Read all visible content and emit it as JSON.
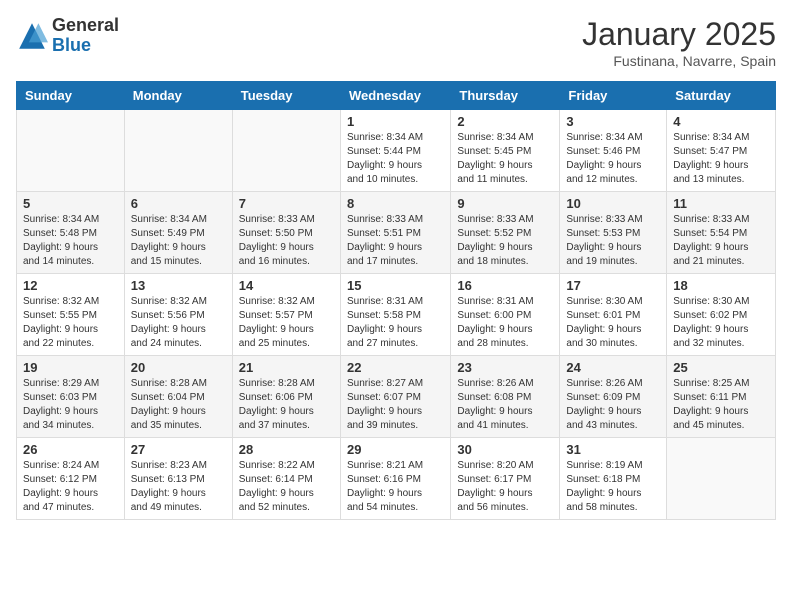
{
  "header": {
    "logo_general": "General",
    "logo_blue": "Blue",
    "month_title": "January 2025",
    "location": "Fustinana, Navarre, Spain"
  },
  "weekdays": [
    "Sunday",
    "Monday",
    "Tuesday",
    "Wednesday",
    "Thursday",
    "Friday",
    "Saturday"
  ],
  "weeks": [
    [
      {
        "day": "",
        "info": ""
      },
      {
        "day": "",
        "info": ""
      },
      {
        "day": "",
        "info": ""
      },
      {
        "day": "1",
        "info": "Sunrise: 8:34 AM\nSunset: 5:44 PM\nDaylight: 9 hours\nand 10 minutes."
      },
      {
        "day": "2",
        "info": "Sunrise: 8:34 AM\nSunset: 5:45 PM\nDaylight: 9 hours\nand 11 minutes."
      },
      {
        "day": "3",
        "info": "Sunrise: 8:34 AM\nSunset: 5:46 PM\nDaylight: 9 hours\nand 12 minutes."
      },
      {
        "day": "4",
        "info": "Sunrise: 8:34 AM\nSunset: 5:47 PM\nDaylight: 9 hours\nand 13 minutes."
      }
    ],
    [
      {
        "day": "5",
        "info": "Sunrise: 8:34 AM\nSunset: 5:48 PM\nDaylight: 9 hours\nand 14 minutes."
      },
      {
        "day": "6",
        "info": "Sunrise: 8:34 AM\nSunset: 5:49 PM\nDaylight: 9 hours\nand 15 minutes."
      },
      {
        "day": "7",
        "info": "Sunrise: 8:33 AM\nSunset: 5:50 PM\nDaylight: 9 hours\nand 16 minutes."
      },
      {
        "day": "8",
        "info": "Sunrise: 8:33 AM\nSunset: 5:51 PM\nDaylight: 9 hours\nand 17 minutes."
      },
      {
        "day": "9",
        "info": "Sunrise: 8:33 AM\nSunset: 5:52 PM\nDaylight: 9 hours\nand 18 minutes."
      },
      {
        "day": "10",
        "info": "Sunrise: 8:33 AM\nSunset: 5:53 PM\nDaylight: 9 hours\nand 19 minutes."
      },
      {
        "day": "11",
        "info": "Sunrise: 8:33 AM\nSunset: 5:54 PM\nDaylight: 9 hours\nand 21 minutes."
      }
    ],
    [
      {
        "day": "12",
        "info": "Sunrise: 8:32 AM\nSunset: 5:55 PM\nDaylight: 9 hours\nand 22 minutes."
      },
      {
        "day": "13",
        "info": "Sunrise: 8:32 AM\nSunset: 5:56 PM\nDaylight: 9 hours\nand 24 minutes."
      },
      {
        "day": "14",
        "info": "Sunrise: 8:32 AM\nSunset: 5:57 PM\nDaylight: 9 hours\nand 25 minutes."
      },
      {
        "day": "15",
        "info": "Sunrise: 8:31 AM\nSunset: 5:58 PM\nDaylight: 9 hours\nand 27 minutes."
      },
      {
        "day": "16",
        "info": "Sunrise: 8:31 AM\nSunset: 6:00 PM\nDaylight: 9 hours\nand 28 minutes."
      },
      {
        "day": "17",
        "info": "Sunrise: 8:30 AM\nSunset: 6:01 PM\nDaylight: 9 hours\nand 30 minutes."
      },
      {
        "day": "18",
        "info": "Sunrise: 8:30 AM\nSunset: 6:02 PM\nDaylight: 9 hours\nand 32 minutes."
      }
    ],
    [
      {
        "day": "19",
        "info": "Sunrise: 8:29 AM\nSunset: 6:03 PM\nDaylight: 9 hours\nand 34 minutes."
      },
      {
        "day": "20",
        "info": "Sunrise: 8:28 AM\nSunset: 6:04 PM\nDaylight: 9 hours\nand 35 minutes."
      },
      {
        "day": "21",
        "info": "Sunrise: 8:28 AM\nSunset: 6:06 PM\nDaylight: 9 hours\nand 37 minutes."
      },
      {
        "day": "22",
        "info": "Sunrise: 8:27 AM\nSunset: 6:07 PM\nDaylight: 9 hours\nand 39 minutes."
      },
      {
        "day": "23",
        "info": "Sunrise: 8:26 AM\nSunset: 6:08 PM\nDaylight: 9 hours\nand 41 minutes."
      },
      {
        "day": "24",
        "info": "Sunrise: 8:26 AM\nSunset: 6:09 PM\nDaylight: 9 hours\nand 43 minutes."
      },
      {
        "day": "25",
        "info": "Sunrise: 8:25 AM\nSunset: 6:11 PM\nDaylight: 9 hours\nand 45 minutes."
      }
    ],
    [
      {
        "day": "26",
        "info": "Sunrise: 8:24 AM\nSunset: 6:12 PM\nDaylight: 9 hours\nand 47 minutes."
      },
      {
        "day": "27",
        "info": "Sunrise: 8:23 AM\nSunset: 6:13 PM\nDaylight: 9 hours\nand 49 minutes."
      },
      {
        "day": "28",
        "info": "Sunrise: 8:22 AM\nSunset: 6:14 PM\nDaylight: 9 hours\nand 52 minutes."
      },
      {
        "day": "29",
        "info": "Sunrise: 8:21 AM\nSunset: 6:16 PM\nDaylight: 9 hours\nand 54 minutes."
      },
      {
        "day": "30",
        "info": "Sunrise: 8:20 AM\nSunset: 6:17 PM\nDaylight: 9 hours\nand 56 minutes."
      },
      {
        "day": "31",
        "info": "Sunrise: 8:19 AM\nSunset: 6:18 PM\nDaylight: 9 hours\nand 58 minutes."
      },
      {
        "day": "",
        "info": ""
      }
    ]
  ]
}
